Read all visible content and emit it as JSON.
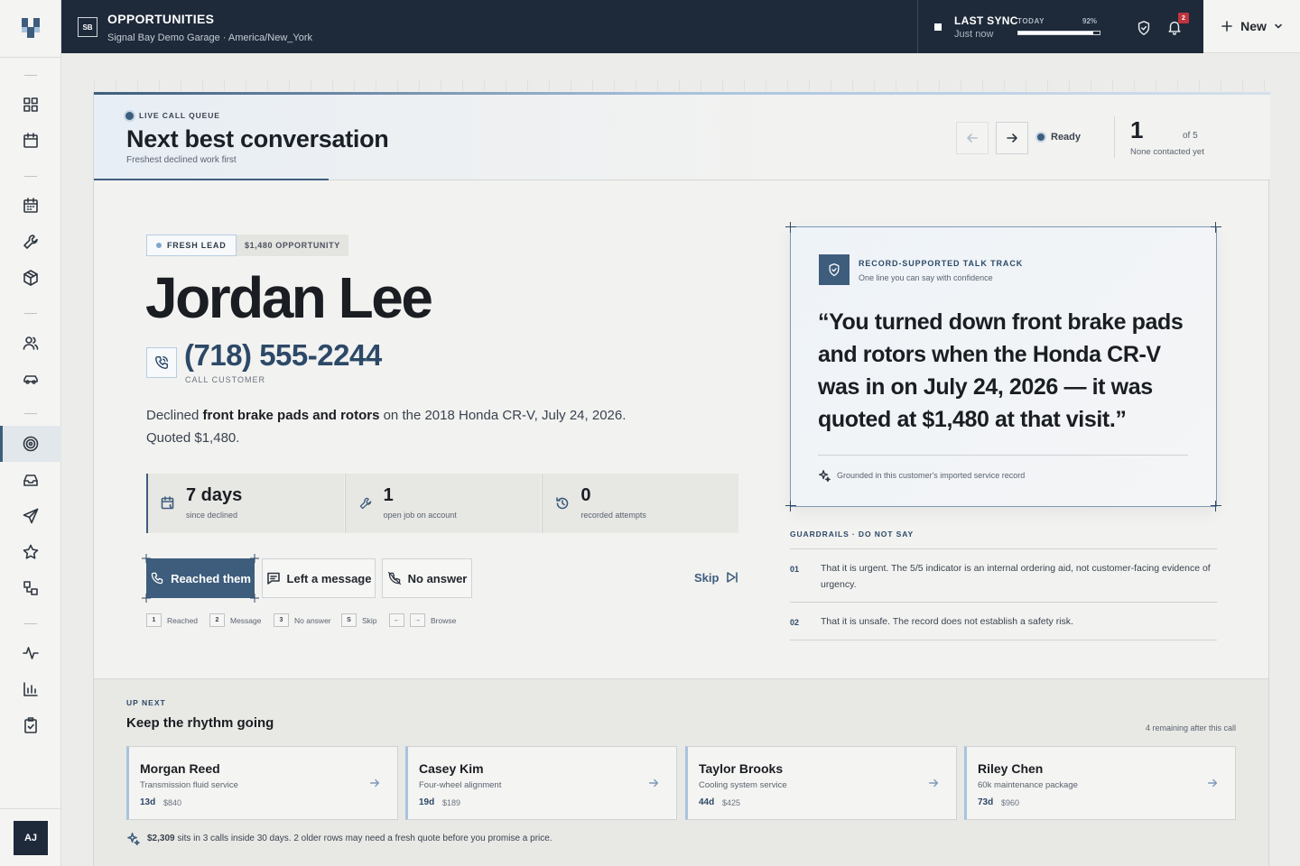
{
  "app": {
    "title": "OPPORTUNITIES",
    "subtitle": "Signal Bay Demo Garage · America/New_York",
    "workspace_initials": "SB",
    "user_initials": "AJ"
  },
  "sync": {
    "label": "LAST SYNC",
    "status": "Just now",
    "today_label": "TODAY",
    "progress_label": "92%",
    "progress": 0.92
  },
  "notifications": {
    "count": "2"
  },
  "new_button": {
    "label": "New"
  },
  "sidebar": {
    "icons": [
      "grid-icon",
      "calendar-icon",
      "calendar-grid-icon",
      "wrench-icon",
      "box-icon",
      "users-icon",
      "car-icon",
      "target-icon",
      "inbox-icon",
      "send-icon",
      "star-icon",
      "workflow-icon",
      "activity-icon",
      "bar-chart-icon",
      "clipboard-check-icon"
    ],
    "active": "target-icon"
  },
  "queue": {
    "eyebrow": "LIVE CALL QUEUE",
    "title": "Next best conversation",
    "subtitle": "Freshest declined work first",
    "status": "Ready",
    "position": "1",
    "total": "of 5",
    "contacted": "None contacted yet"
  },
  "lead": {
    "tag_fresh": "FRESH LEAD",
    "tag_value": "$1,480 OPPORTUNITY",
    "name": "Jordan Lee",
    "phone": "(718) 555-2244",
    "call_label": "CALL CUSTOMER",
    "desc_pre": "Declined ",
    "desc_service": "front brake pads and rotors",
    "desc_post": " on the 2018 Honda CR-V, July 24, 2026. Quoted $1,480.",
    "stats": [
      {
        "value": "7 days",
        "label": "since declined",
        "icon": "calendar-clock-icon"
      },
      {
        "value": "1",
        "label": "open job on account",
        "icon": "wrench-icon"
      },
      {
        "value": "0",
        "label": "recorded attempts",
        "icon": "history-icon"
      }
    ]
  },
  "actions": {
    "reached": "Reached them",
    "message": "Left a message",
    "no_answer": "No answer",
    "skip": "Skip"
  },
  "shortcuts": [
    {
      "key": "1",
      "label": "Reached"
    },
    {
      "key": "2",
      "label": "Message"
    },
    {
      "key": "3",
      "label": "No answer"
    },
    {
      "key": "S",
      "label": "Skip"
    },
    {
      "key": "←",
      "key2": "→",
      "label": "Browse"
    }
  ],
  "talk_track": {
    "title": "RECORD-SUPPORTED TALK TRACK",
    "subtitle": "One line you can say with confidence",
    "quote": "“You turned down front brake pads and rotors when the Honda CR-V was in on July 24, 2026 — it was quoted at $1,480 at that visit.”",
    "grounded": "Grounded in this customer's imported service record"
  },
  "guardrails": {
    "title": "GUARDRAILS · DO NOT SAY",
    "items": [
      {
        "num": "01",
        "text": "That it is urgent. The 5/5 indicator is an internal ordering aid, not customer-facing evidence of urgency."
      },
      {
        "num": "02",
        "text": "That it is unsafe. The record does not establish a safety risk."
      }
    ]
  },
  "up_next": {
    "eyebrow": "UP NEXT",
    "title": "Keep the rhythm going",
    "remaining": "4 remaining after this call",
    "cards": [
      {
        "name": "Morgan Reed",
        "service": "Transmission fluid service",
        "days": "13d",
        "amount": "$840"
      },
      {
        "name": "Casey Kim",
        "service": "Four-wheel alignment",
        "days": "19d",
        "amount": "$189"
      },
      {
        "name": "Taylor Brooks",
        "service": "Cooling system service",
        "days": "44d",
        "amount": "$425"
      },
      {
        "name": "Riley Chen",
        "service": "60k maintenance package",
        "days": "73d",
        "amount": "$960"
      }
    ],
    "footer_amount": "$2,309",
    "footer_text": " sits in 3 calls inside 30 days. 2 older rows may need a fresh quote before you promise a price."
  },
  "colors": {
    "navy": "#1e2a3a",
    "accent": "#3e5d7d",
    "accent_light": "#a9c3de",
    "badge": "#c0343f"
  }
}
